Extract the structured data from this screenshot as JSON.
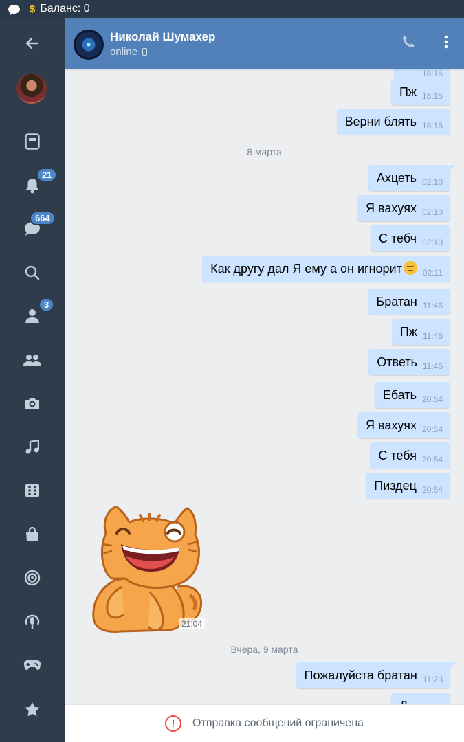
{
  "status_bar": {
    "balance": "Баланс: 0"
  },
  "sidebar": {
    "badges": {
      "notifications": "21",
      "messages": "664",
      "friends": "3"
    },
    "icons": [
      "back-arrow-icon",
      "avatar",
      "newsfeed-icon",
      "bell-icon",
      "messages-icon",
      "search-icon",
      "friends-icon",
      "communities-icon",
      "camera-icon",
      "music-icon",
      "apps-icon",
      "shop-icon",
      "target-icon",
      "podcast-icon",
      "games-icon",
      "star-icon"
    ]
  },
  "header": {
    "name": "Николай Шумахер",
    "status": "online"
  },
  "messages": {
    "partial_top": {
      "time": "18:15"
    },
    "m1": {
      "text": "Пж",
      "time": "18:15"
    },
    "m2": {
      "text": "Верни блять",
      "time": "18:15"
    },
    "date1": "8 марта",
    "m3": {
      "text": "Ахцеть",
      "time": "02:10"
    },
    "m4": {
      "text": "Я вахуях",
      "time": "02:10"
    },
    "m5": {
      "text": "С тебч",
      "time": "02:10"
    },
    "m6": {
      "text": "Как другу дал Я ему а он игнорит",
      "emoji": "pensive-face",
      "time": "02:11"
    },
    "m7": {
      "text": "Братан",
      "time": "11:46"
    },
    "m8": {
      "text": "Пж",
      "time": "11:46"
    },
    "m9": {
      "text": "Ответь",
      "time": "11:46"
    },
    "m10": {
      "text": "Ебать",
      "time": "20:54"
    },
    "m11": {
      "text": "Я вахуях",
      "time": "20:54"
    },
    "m12": {
      "text": "С тебя",
      "time": "20:54"
    },
    "m13": {
      "text": "Пиздец",
      "time": "20:54"
    },
    "sticker": {
      "description": "laughing-orange-cat-sticker",
      "time": "21:04"
    },
    "date2": "Вчера, 9 марта",
    "m14": {
      "text": "Пожалуйста братан",
      "time": "11:23"
    },
    "partial_bottom": {
      "text": "Д..."
    }
  },
  "footer": {
    "notice": "Отправка сообщений ограничена"
  },
  "colors": {
    "header_bg": "#5181b8",
    "sidebar_bg": "#2f3c4b",
    "bubble_out": "#cce4ff",
    "chat_bg": "#edeef0",
    "badge": "#4a86c9",
    "warning": "#e64646"
  }
}
